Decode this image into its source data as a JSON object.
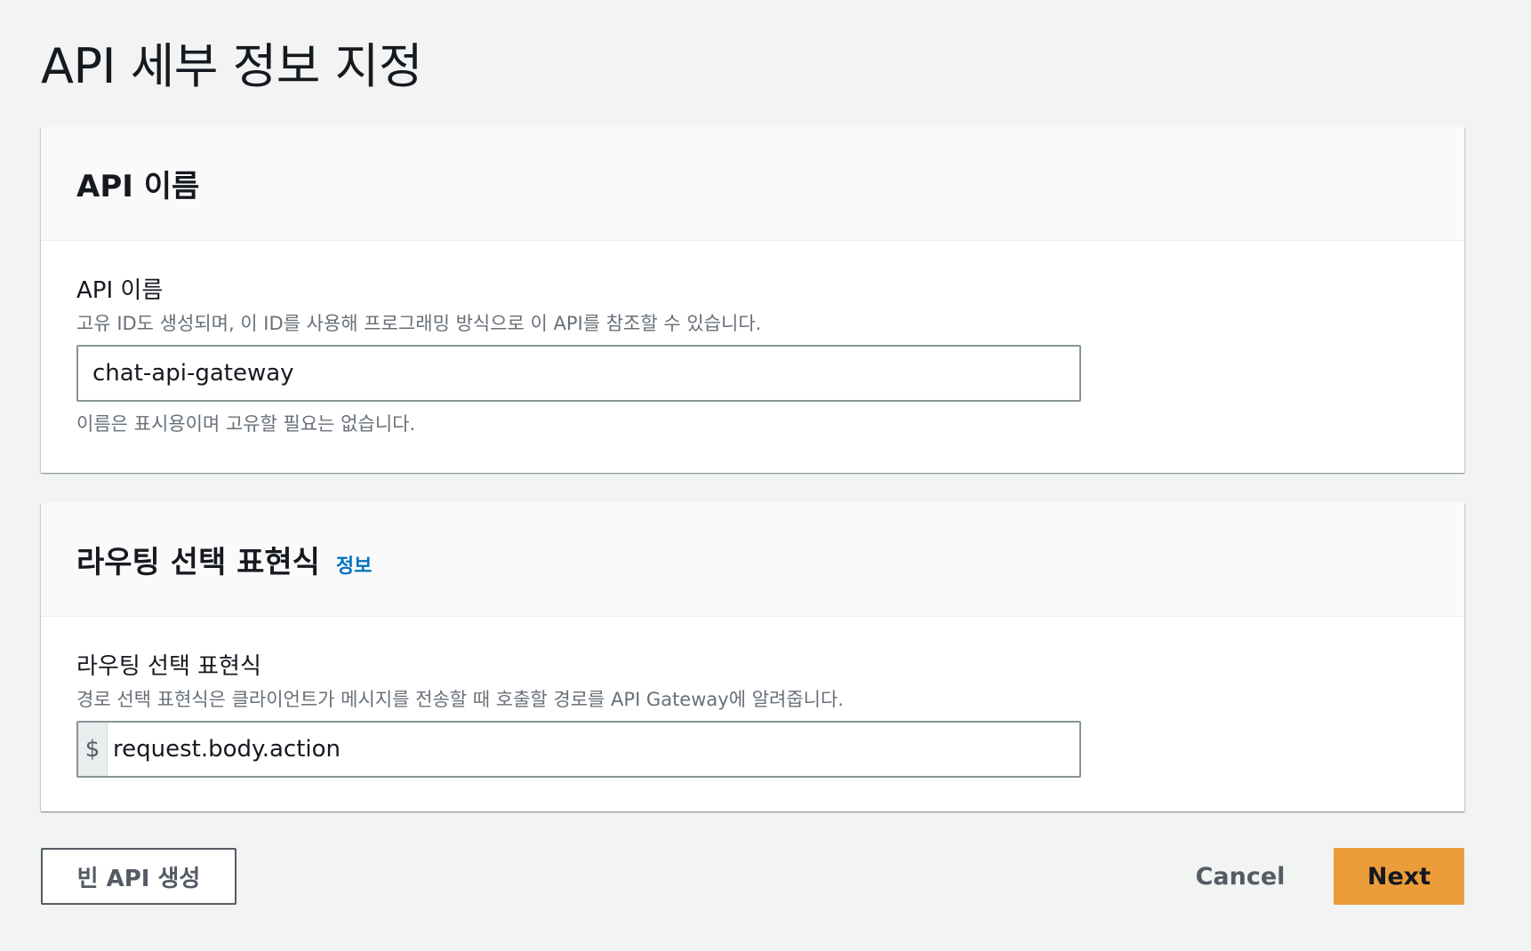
{
  "page": {
    "title": "API 세부 정보 지정"
  },
  "api_name_section": {
    "header_title": "API 이름",
    "field_label": "API 이름",
    "field_description": "고유 ID도 생성되며, 이 ID를 사용해 프로그래밍 방식으로 이 API를 참조할 수 있습니다.",
    "input_value": "chat-api-gateway",
    "constraint_text": "이름은 표시용이며 고유할 필요는 없습니다."
  },
  "route_selection_section": {
    "header_title": "라우팅 선택 표현식",
    "info_link": "정보",
    "field_label": "라우팅 선택 표현식",
    "field_description": "경로 선택 표현식은 클라이언트가 메시지를 전송할 때 호출할 경로를 API Gateway에 알려줍니다.",
    "input_prefix": "$",
    "input_value": "request.body.action"
  },
  "footer": {
    "create_empty_label": "빈 API 생성",
    "cancel_label": "Cancel",
    "next_label": "Next"
  },
  "colors": {
    "primary_button": "#ec9d3a",
    "link": "#0073bb",
    "background": "#f2f3f3"
  }
}
